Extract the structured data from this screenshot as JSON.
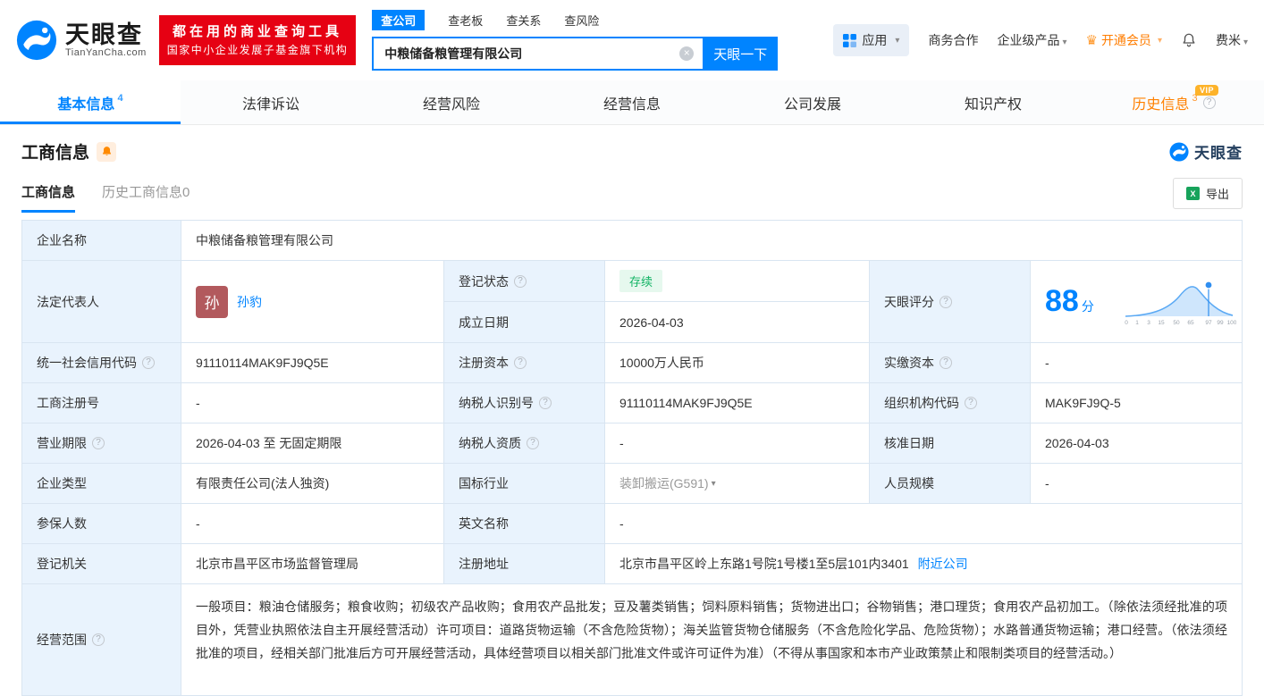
{
  "colors": {
    "accent": "#0084ff",
    "vip_orange": "#ff7d00",
    "status_green": "#12b364",
    "banner_red": "#e60113"
  },
  "icons": {
    "help": "?",
    "caret": "▾",
    "clear": "×",
    "excel": "X",
    "crown": "♛"
  },
  "header": {
    "brand": "天眼查",
    "brand_domain": "TianYanCha.com",
    "banner": {
      "line1": "都在用的商业查询工具",
      "line2": "国家中小企业发展子基金旗下机构"
    },
    "search": {
      "tabs": [
        {
          "label": "查公司"
        },
        {
          "label": "查老板"
        },
        {
          "label": "查关系"
        },
        {
          "label": "查风险"
        }
      ],
      "value": "中粮储备粮管理有限公司",
      "button": "天眼一下"
    },
    "menu": {
      "apps": "应用",
      "cooperation": "商务合作",
      "enterprise": "企业级产品",
      "vip": "开通会员",
      "user": "费米"
    }
  },
  "nav": {
    "tabs": [
      {
        "label": "基本信息",
        "badge": "4"
      },
      {
        "label": "法律诉讼"
      },
      {
        "label": "经营风险"
      },
      {
        "label": "经营信息"
      },
      {
        "label": "公司发展"
      },
      {
        "label": "知识产权"
      },
      {
        "label": "历史信息",
        "badge": "3",
        "vip": "VIP"
      }
    ]
  },
  "section": {
    "title": "工商信息",
    "brand": "天眼查",
    "tabs": [
      {
        "label": "工商信息"
      },
      {
        "label": "历史工商信息0"
      }
    ],
    "export": "导出"
  },
  "score_chart": {
    "ticks": [
      "0",
      "1",
      "3",
      "15",
      "50",
      "65",
      "97",
      "99",
      "100"
    ]
  },
  "table": {
    "company_name": {
      "label": "企业名称",
      "value": "中粮储备粮管理有限公司"
    },
    "legal_rep": {
      "label": "法定代表人",
      "avatar": "孙",
      "value": "孙豹"
    },
    "reg_status": {
      "label": "登记状态",
      "value": "存续"
    },
    "establish_date": {
      "label": "成立日期",
      "value": "2026-04-03"
    },
    "score": {
      "label": "天眼评分",
      "value": "88",
      "unit": "分"
    },
    "credit_code": {
      "label": "统一社会信用代码",
      "value": "91110114MAK9FJ9Q5E"
    },
    "reg_capital": {
      "label": "注册资本",
      "value": "10000万人民币"
    },
    "paid_capital": {
      "label": "实缴资本",
      "value": "-"
    },
    "reg_number": {
      "label": "工商注册号",
      "value": "-"
    },
    "taxpayer_id": {
      "label": "纳税人识别号",
      "value": "91110114MAK9FJ9Q5E"
    },
    "org_code": {
      "label": "组织机构代码",
      "value": "MAK9FJ9Q-5"
    },
    "business_term": {
      "label": "营业期限",
      "value": "2026-04-03 至 无固定期限"
    },
    "taxpayer_quality": {
      "label": "纳税人资质",
      "value": "-"
    },
    "approval_date": {
      "label": "核准日期",
      "value": "2026-04-03"
    },
    "company_type": {
      "label": "企业类型",
      "value": "有限责任公司(法人独资)"
    },
    "industry": {
      "label": "国标行业",
      "value": "装卸搬运(G591)"
    },
    "staff_size": {
      "label": "人员规模",
      "value": "-"
    },
    "insured_count": {
      "label": "参保人数",
      "value": "-"
    },
    "english_name": {
      "label": "英文名称",
      "value": "-"
    },
    "reg_authority": {
      "label": "登记机关",
      "value": "北京市昌平区市场监督管理局"
    },
    "reg_address": {
      "label": "注册地址",
      "value": "北京市昌平区岭上东路1号院1号楼1至5层101内3401",
      "link": "附近公司"
    },
    "business_scope": {
      "label": "经营范围",
      "value": "一般项目：粮油仓储服务；粮食收购；初级农产品收购；食用农产品批发；豆及薯类销售；饲料原料销售；货物进出口；谷物销售；港口理货；食用农产品初加工。（除依法须经批准的项目外，凭营业执照依法自主开展经营活动）许可项目：道路货物运输（不含危险货物）；海关监管货物仓储服务（不含危险化学品、危险货物）；水路普通货物运输；港口经营。（依法须经批准的项目，经相关部门批准后方可开展经营活动，具体经营项目以相关部门批准文件或许可证件为准）（不得从事国家和本市产业政策禁止和限制类项目的经营活动。）"
    }
  }
}
